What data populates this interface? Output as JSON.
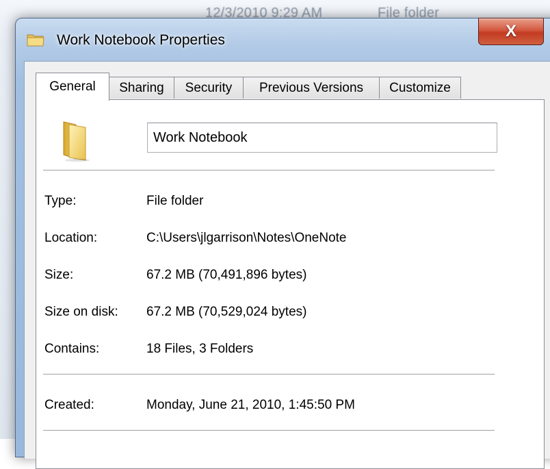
{
  "background_window": {
    "modified": "12/3/2010 9:29 AM",
    "type": "File folder"
  },
  "dialog": {
    "title": "Work Notebook Properties",
    "close_label": "X",
    "folder_icon": "folder-icon"
  },
  "tabs": [
    {
      "label": "General",
      "active": true
    },
    {
      "label": "Sharing",
      "active": false
    },
    {
      "label": "Security",
      "active": false
    },
    {
      "label": "Previous Versions",
      "active": false
    },
    {
      "label": "Customize",
      "active": false
    }
  ],
  "general": {
    "name_value": "Work Notebook",
    "properties": [
      {
        "label": "Type:",
        "value": "File folder"
      },
      {
        "label": "Location:",
        "value": "C:\\Users\\jlgarrison\\Notes\\OneNote"
      },
      {
        "label": "Size:",
        "value": "67.2 MB (70,491,896 bytes)"
      },
      {
        "label": "Size on disk:",
        "value": "67.2 MB (70,529,024 bytes)"
      },
      {
        "label": "Contains:",
        "value": "18 Files, 3 Folders"
      },
      {
        "label": "Created:",
        "value": "Monday, June 21, 2010, 1:45:50 PM"
      }
    ]
  },
  "colors": {
    "glass": "#b0c9e6",
    "close_red": "#c23a22",
    "panel": "#ffffff",
    "client": "#f0f0f0"
  }
}
